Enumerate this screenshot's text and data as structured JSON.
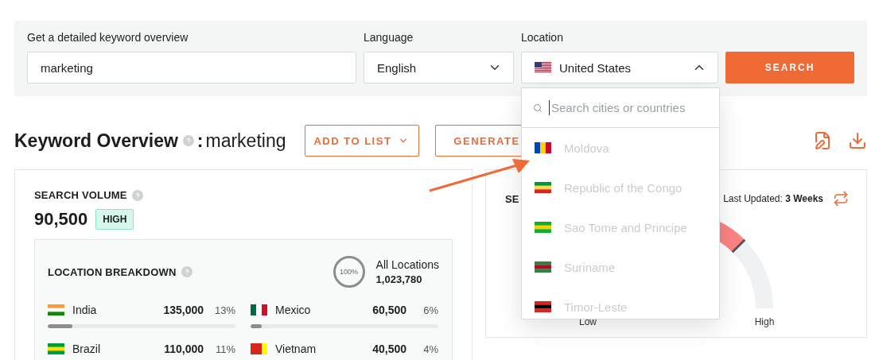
{
  "search_form": {
    "keyword_label": "Get a detailed keyword overview",
    "keyword_value": "marketing",
    "language_label": "Language",
    "language_value": "English",
    "location_label": "Location",
    "location_value": "United States",
    "location_open": true,
    "search_button": "SEARCH"
  },
  "location_dropdown": {
    "placeholder": "Search cities or countries",
    "options": [
      {
        "label": "Moldova"
      },
      {
        "label": "Republic of the Congo"
      },
      {
        "label": "Sao Tome and Principe"
      },
      {
        "label": "Suriname"
      },
      {
        "label": "Timor-Leste"
      }
    ]
  },
  "header": {
    "title": "Keyword Overview",
    "separator": ":",
    "keyword": "marketing",
    "buttons": [
      {
        "label": "ADD TO LIST",
        "kind": "dropdown"
      },
      {
        "label": "GENERATE",
        "kind": "plain"
      }
    ]
  },
  "search_volume": {
    "title": "SEARCH VOLUME",
    "value": "90,500",
    "badge": "HIGH"
  },
  "location_breakdown": {
    "title": "LOCATION BREAKDOWN",
    "total_percent": "100%",
    "total_label": "All Locations",
    "total_value": "1,023,780",
    "rows": [
      {
        "country": "India",
        "volume": "135,000",
        "share": "13%",
        "level": 0.13
      },
      {
        "country": "Mexico",
        "volume": "60,500",
        "share": "6%",
        "level": 0.06
      },
      {
        "country": "Brazil",
        "volume": "110,000",
        "share": "11%"
      },
      {
        "country": "Vietnam",
        "volume": "40,500",
        "share": "4%"
      }
    ]
  },
  "seo_card": {
    "title": "SE",
    "last_updated_label": "Last Updated:",
    "last_updated_value": "3 Weeks",
    "gauge_low": "Low",
    "gauge_high": "High"
  }
}
